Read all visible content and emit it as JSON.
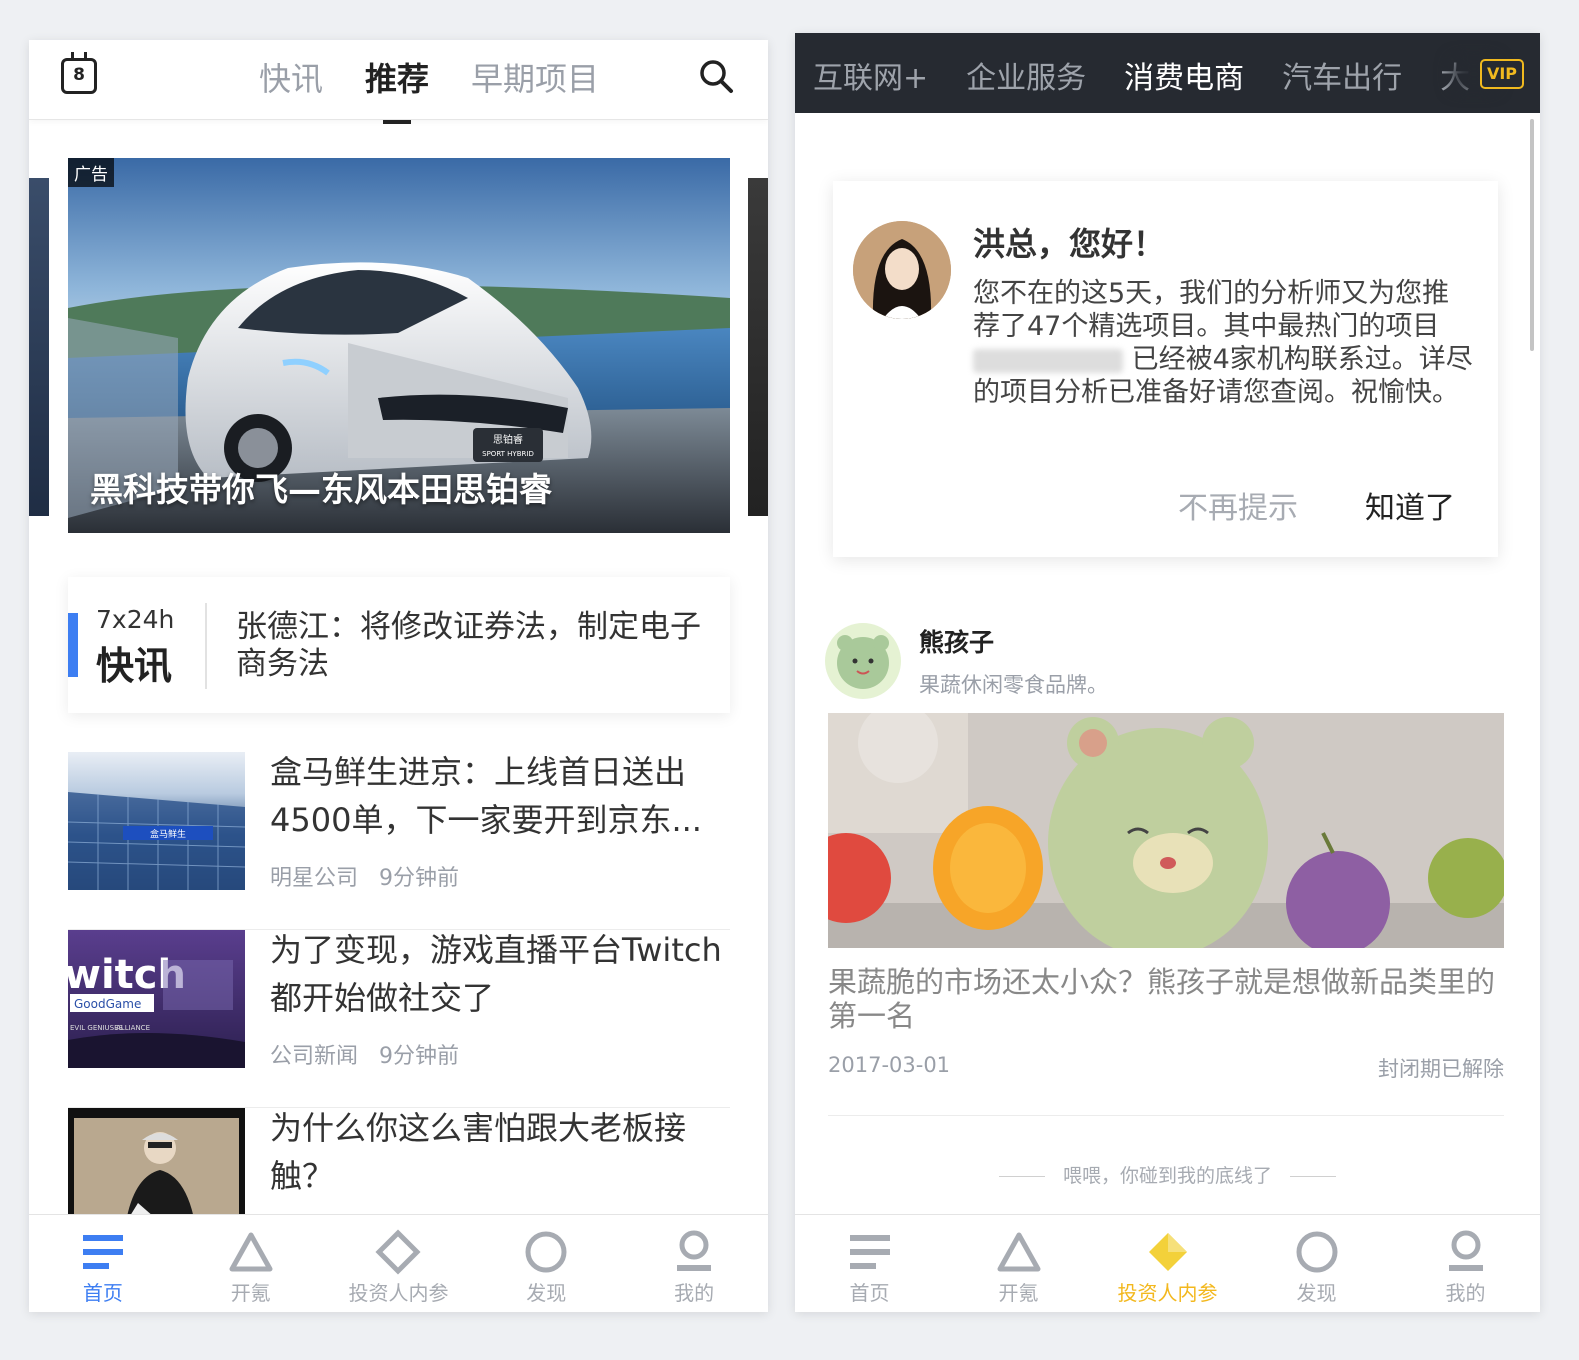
{
  "left": {
    "header": {
      "calendar_day": "8",
      "tabs": [
        {
          "label": "快讯"
        },
        {
          "label": "推荐"
        },
        {
          "label": "早期项目"
        }
      ]
    },
    "banner": {
      "ad_tag": "广告",
      "title": "黑科技带你飞—东风本田思铂睿",
      "car_badge_line1": "思铂睿",
      "car_badge_line2": "SPORT HYBRID"
    },
    "flash": {
      "label_top": "7x24h",
      "label_bottom": "快讯",
      "text": "张德江：将修改证券法，制定电子商务法"
    },
    "news": [
      {
        "title": "盒马鲜生进京：上线首日送出4500单，下一家要开到京东...",
        "category": "明星公司",
        "time": "9分钟前",
        "image_text": "盒马鲜生"
      },
      {
        "title": "为了变现，游戏直播平台Twitch都开始做社交了",
        "category": "公司新闻",
        "time": "9分钟前",
        "image_text": "witch",
        "image_text2": "GoodGame",
        "image_text3": "EVIL GENIUSES",
        "image_text4": "ALLIANCE"
      },
      {
        "title": "为什么你这么害怕跟大老板接触？",
        "category": "",
        "time": ""
      }
    ],
    "tabbar": [
      {
        "label": "首页",
        "icon": "home-icon"
      },
      {
        "label": "开氪",
        "icon": "triangle-icon"
      },
      {
        "label": "投资人内参",
        "icon": "diamond-icon"
      },
      {
        "label": "发现",
        "icon": "circle-icon"
      },
      {
        "label": "我的",
        "icon": "person-icon"
      }
    ]
  },
  "right": {
    "header": {
      "tabs": [
        {
          "label": "互联网+"
        },
        {
          "label": "企业服务"
        },
        {
          "label": "消费电商"
        },
        {
          "label": "汽车出行"
        },
        {
          "label": "大"
        }
      ],
      "vip": "VIP"
    },
    "greeting": {
      "title": "洪总，您好！",
      "body_1": "您不在的这5天，我们的分析师又为您推荐了47个精选项目。其中最热门的项目",
      "body_2": "已经被4家机构联系过。详尽的项目分析已准备好请您查阅。祝愉快。",
      "dismiss": "不再提示",
      "ok": "知道了"
    },
    "company": {
      "name": "熊孩子",
      "desc": "果蔬休闲零食品牌。",
      "title": "果蔬脆的市场还太小众？熊孩子就是想做新品类里的第一名",
      "date": "2017-03-01",
      "status": "封闭期已解除"
    },
    "bottom_line": "喂喂，你碰到我的底线了",
    "tabbar": [
      {
        "label": "首页",
        "icon": "home-icon"
      },
      {
        "label": "开氪",
        "icon": "triangle-icon"
      },
      {
        "label": "投资人内参",
        "icon": "diamond-icon"
      },
      {
        "label": "发现",
        "icon": "circle-icon"
      },
      {
        "label": "我的",
        "icon": "person-icon"
      }
    ]
  },
  "colors": {
    "accent_blue": "#3d7ef2",
    "accent_gold": "#f3b81e",
    "header_dark": "#262a31",
    "inactive": "#a7abb2"
  }
}
